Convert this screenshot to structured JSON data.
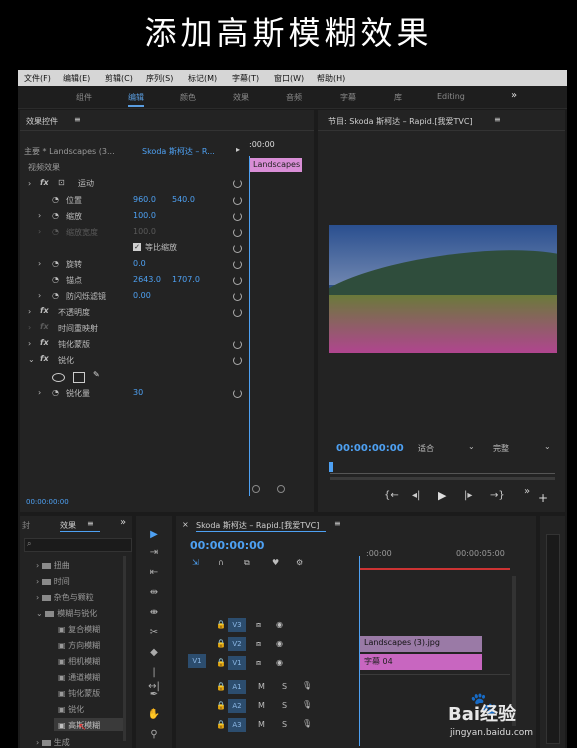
{
  "banner": {
    "title": "添加高斯模糊效果"
  },
  "menu": [
    "文件(F)",
    "编辑(E)",
    "剪辑(C)",
    "序列(S)",
    "标记(M)",
    "字幕(T)",
    "窗口(W)",
    "帮助(H)"
  ],
  "workspaces": [
    "组件",
    "编辑",
    "颜色",
    "效果",
    "音频",
    "字幕",
    "库",
    "Editing"
  ],
  "workspace_more": "»",
  "effect_controls": {
    "title": "效果控件",
    "source_label": "主要 * Landscapes (3...",
    "sequence_label": "Skoda 斯柯达 – R...",
    "video_effects": "视频效果",
    "ruler_time": ":00:00",
    "clip_name": "Landscapes",
    "motion": "运动",
    "position_label": "位置",
    "position_x": "960.0",
    "position_y": "540.0",
    "scale_label": "缩放",
    "scale_value": "100.0",
    "scale_width_label": "缩放宽度",
    "scale_width_value": "100.0",
    "uniform_scale": "等比缩放",
    "rotation_label": "旋转",
    "rotation_value": "0.0",
    "anchor_label": "锚点",
    "anchor_x": "2643.0",
    "anchor_y": "1707.0",
    "antiflicker_label": "防闪烁滤镜",
    "antiflicker_value": "0.00",
    "opacity": "不透明度",
    "time_remap": "时间重映射",
    "posterize": "钝化蒙版",
    "sharpen": "锐化",
    "sharpen_amount_label": "锐化量",
    "sharpen_amount_value": "30",
    "timecode": "00:00:00:00"
  },
  "program_monitor": {
    "title": "节目: Skoda 斯柯达 – Rapid.[我爱TVC]",
    "timecode": "00:00:00:00",
    "fit": "适合",
    "quality": "完整"
  },
  "effects_panel": {
    "tab_left": "封",
    "title": "效果",
    "items": [
      "扭曲",
      "时间",
      "杂色与颗粒",
      "模糊与锐化",
      "复合模糊",
      "方向模糊",
      "相机模糊",
      "通道模糊",
      "钝化蒙版",
      "锐化",
      "高斯模糊",
      "生成"
    ]
  },
  "timeline": {
    "title": "Skoda 斯柯达 – Rapid.[我爱TVC]",
    "timecode": "00:00:00:00",
    "ruler_start": ":00:00",
    "ruler_mid": "00:00:05:00",
    "tracks": [
      "V3",
      "V2",
      "V1",
      "A1",
      "A2",
      "A3"
    ],
    "source_track": "V1",
    "clip_v2": "Landscapes (3).jpg",
    "clip_v1": "字幕 04"
  },
  "watermark": {
    "text": "Bai经验",
    "url": "jingyan.baidu.com"
  }
}
